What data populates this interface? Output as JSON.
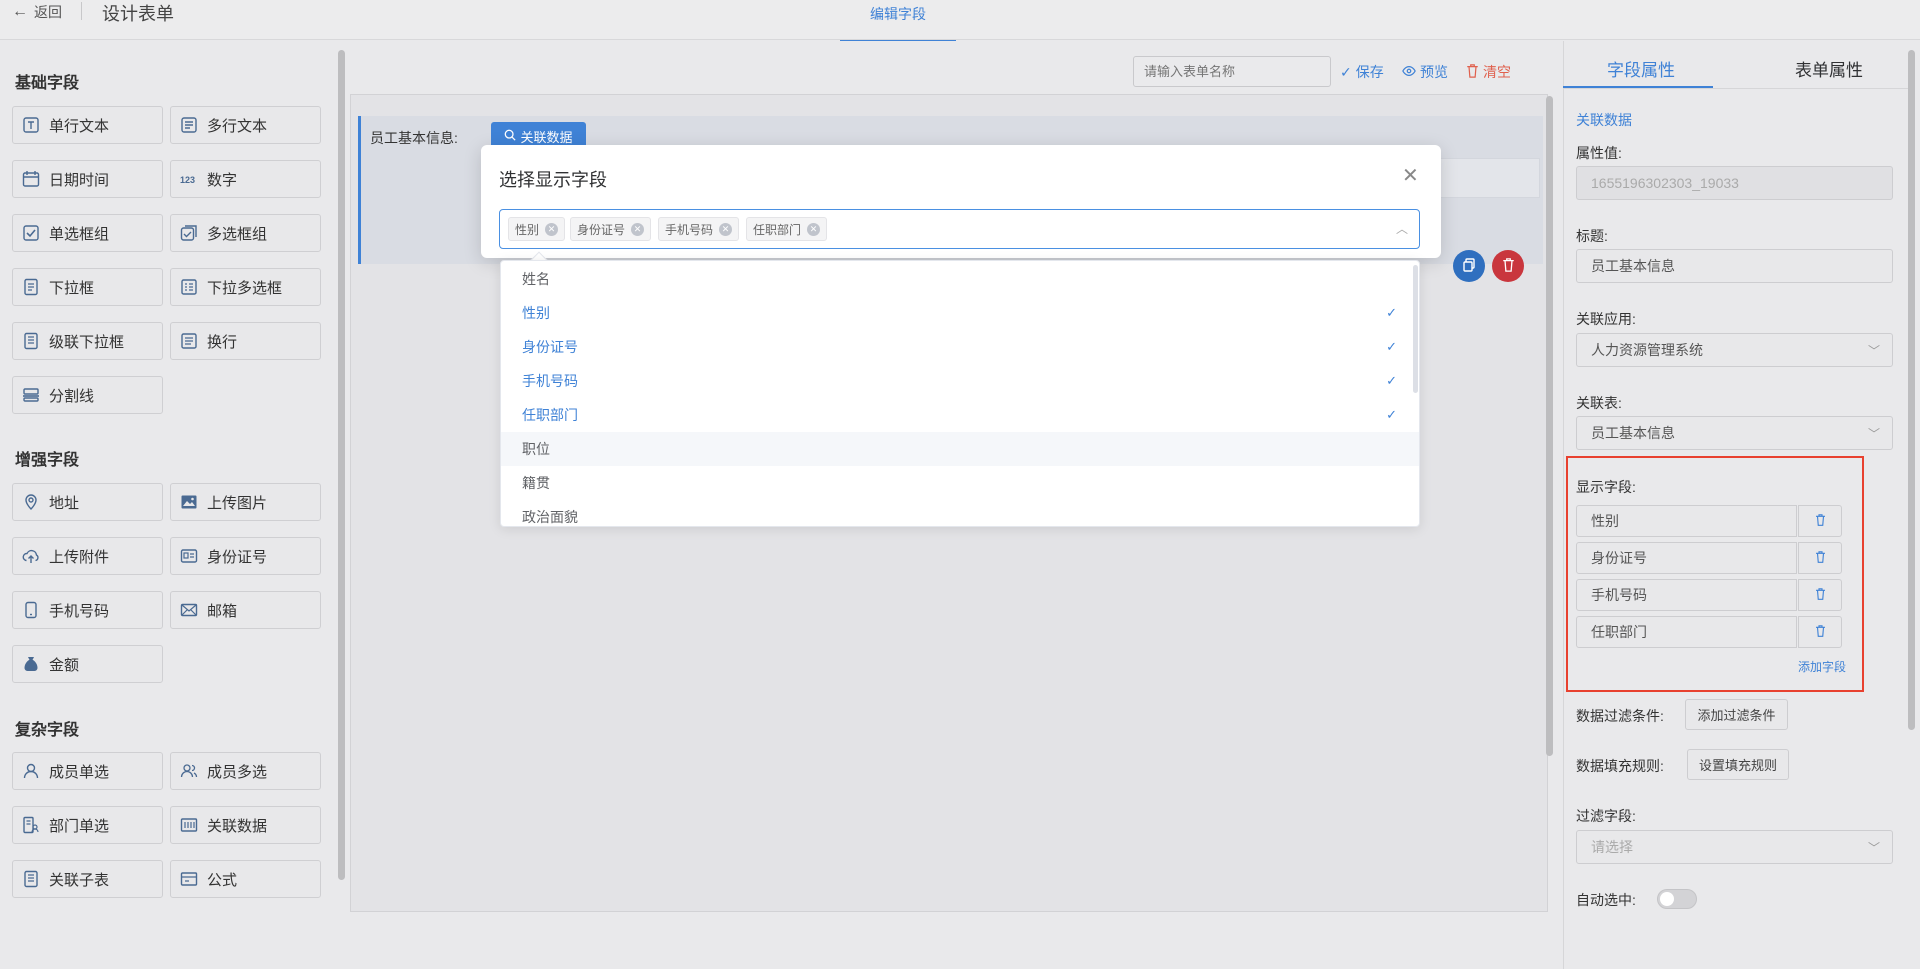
{
  "header": {
    "back_label": "返回",
    "title": "设计表单",
    "active_tab": "编辑字段"
  },
  "left": {
    "sections": [
      {
        "title": "基础字段"
      },
      {
        "title": "增强字段"
      },
      {
        "title": "复杂字段"
      }
    ],
    "fields": [
      {
        "label": "单行文本",
        "icon": "single-line-text-icon"
      },
      {
        "label": "多行文本",
        "icon": "multi-line-text-icon"
      },
      {
        "label": "日期时间",
        "icon": "calendar-icon"
      },
      {
        "label": "数字",
        "icon": "number-icon"
      },
      {
        "label": "单选框组",
        "icon": "radio-icon"
      },
      {
        "label": "多选框组",
        "icon": "checkbox-icon"
      },
      {
        "label": "下拉框",
        "icon": "dropdown-icon"
      },
      {
        "label": "下拉多选框",
        "icon": "multi-dropdown-icon"
      },
      {
        "label": "级联下拉框",
        "icon": "cascade-icon"
      },
      {
        "label": "换行",
        "icon": "line-break-icon"
      },
      {
        "label": "分割线",
        "icon": "divider-icon"
      },
      {
        "label": "地址",
        "icon": "location-icon"
      },
      {
        "label": "上传图片",
        "icon": "image-icon"
      },
      {
        "label": "上传附件",
        "icon": "upload-icon"
      },
      {
        "label": "身份证号",
        "icon": "id-card-icon"
      },
      {
        "label": "手机号码",
        "icon": "phone-icon"
      },
      {
        "label": "邮箱",
        "icon": "mail-icon"
      },
      {
        "label": "金额",
        "icon": "money-bag-icon"
      },
      {
        "label": "成员单选",
        "icon": "user-icon"
      },
      {
        "label": "成员多选",
        "icon": "users-icon"
      },
      {
        "label": "部门单选",
        "icon": "department-icon"
      },
      {
        "label": "关联数据",
        "icon": "link-data-icon"
      },
      {
        "label": "关联子表",
        "icon": "subtable-icon"
      },
      {
        "label": "公式",
        "icon": "formula-icon"
      }
    ]
  },
  "toolbar": {
    "form_name_placeholder": "请输入表单名称",
    "save_label": "保存",
    "preview_label": "预览",
    "clear_label": "清空"
  },
  "canvas": {
    "field_label": "员工基本信息:",
    "assoc_button_label": "关联数据"
  },
  "modal": {
    "title": "选择显示字段",
    "selected_tags": [
      "性别",
      "身份证号",
      "手机号码",
      "任职部门"
    ],
    "options": [
      {
        "label": "姓名",
        "selected": false
      },
      {
        "label": "性别",
        "selected": true
      },
      {
        "label": "身份证号",
        "selected": true
      },
      {
        "label": "手机号码",
        "selected": true
      },
      {
        "label": "任职部门",
        "selected": true
      },
      {
        "label": "职位",
        "selected": false
      },
      {
        "label": "籍贯",
        "selected": false
      },
      {
        "label": "政治面貌",
        "selected": false
      }
    ]
  },
  "right": {
    "tabs": [
      "字段属性",
      "表单属性"
    ],
    "type_link": "关联数据",
    "attr_value_label": "属性值:",
    "attr_value": "1655196302303_19033",
    "title_label": "标题:",
    "title_value": "员工基本信息",
    "app_label": "关联应用:",
    "app_value": "人力资源管理系统",
    "table_label": "关联表:",
    "table_value": "员工基本信息",
    "display_fields_label": "显示字段:",
    "display_fields": [
      "性别",
      "身份证号",
      "手机号码",
      "任职部门"
    ],
    "add_field_label": "添加字段",
    "filter_label": "数据过滤条件:",
    "filter_button": "添加过滤条件",
    "fill_label": "数据填充规则:",
    "fill_button": "设置填充规则",
    "filter_field_label": "过滤字段:",
    "filter_field_placeholder": "请选择",
    "auto_select_label": "自动选中:"
  },
  "colors": {
    "accent": "#3f82d6",
    "danger": "#e0604d",
    "highlight": "#e8412f"
  }
}
